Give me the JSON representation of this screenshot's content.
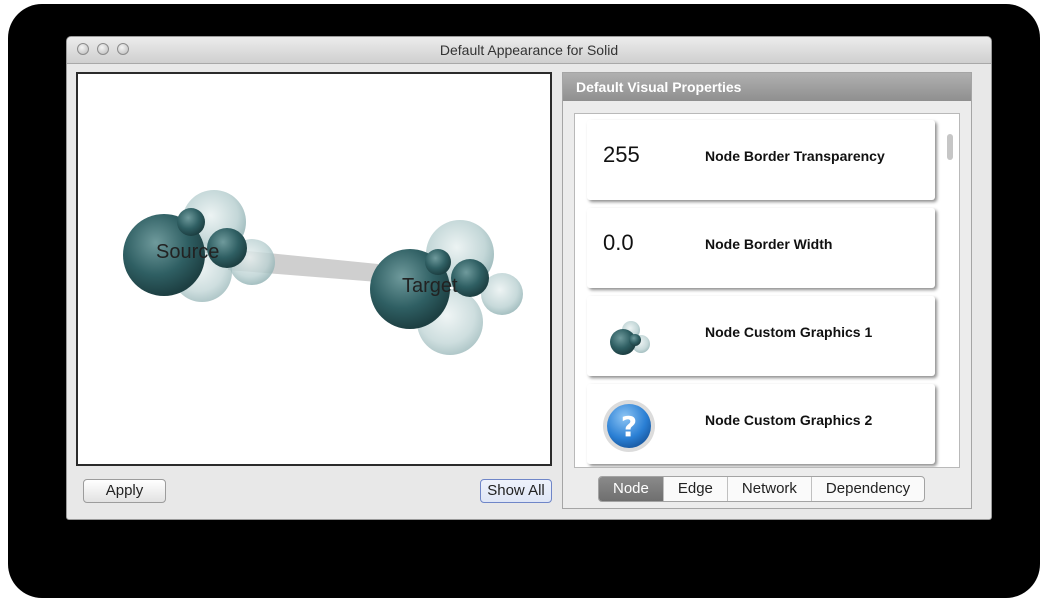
{
  "window": {
    "title": "Default Appearance for Solid"
  },
  "preview": {
    "nodes": [
      {
        "label": "Source"
      },
      {
        "label": "Target"
      }
    ]
  },
  "buttons": {
    "apply": "Apply",
    "show_all": "Show All"
  },
  "panel": {
    "title": "Default Visual Properties",
    "properties": [
      {
        "value": "255",
        "label": "Node Border Transparency"
      },
      {
        "value": "0.0",
        "label": "Node Border Width"
      },
      {
        "value": "",
        "icon": "bubble-cluster-icon",
        "label": "Node Custom Graphics 1"
      },
      {
        "value": "",
        "icon": "question-mark-icon",
        "label": "Node Custom Graphics 2"
      }
    ],
    "tabs": [
      "Node",
      "Edge",
      "Network",
      "Dependency"
    ],
    "active_tab": "Node"
  },
  "colors": {
    "node_fill": "#2f5f63",
    "header": "#9d9d9d",
    "active_tab": "#7a7a7a",
    "help_blue": "#2a7fd4"
  }
}
